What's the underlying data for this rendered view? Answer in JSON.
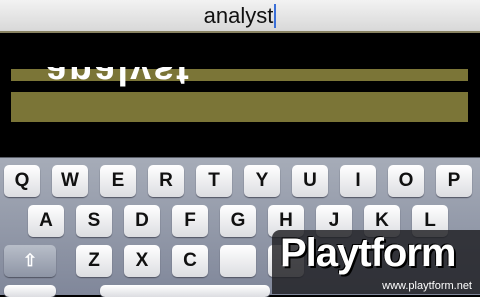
{
  "search": {
    "value": "analyst"
  },
  "game": {
    "flipped_word": "analyst"
  },
  "keyboard": {
    "row1": [
      "Q",
      "W",
      "E",
      "R",
      "T",
      "Y",
      "U",
      "I",
      "O",
      "P"
    ],
    "row2": [
      "A",
      "S",
      "D",
      "F",
      "G",
      "H",
      "J",
      "K",
      "L"
    ],
    "row3": [
      "Z",
      "X",
      "C"
    ],
    "shift_label": "⇧"
  },
  "watermark": {
    "brand": "Playtform",
    "site": "www.playtform.net"
  }
}
